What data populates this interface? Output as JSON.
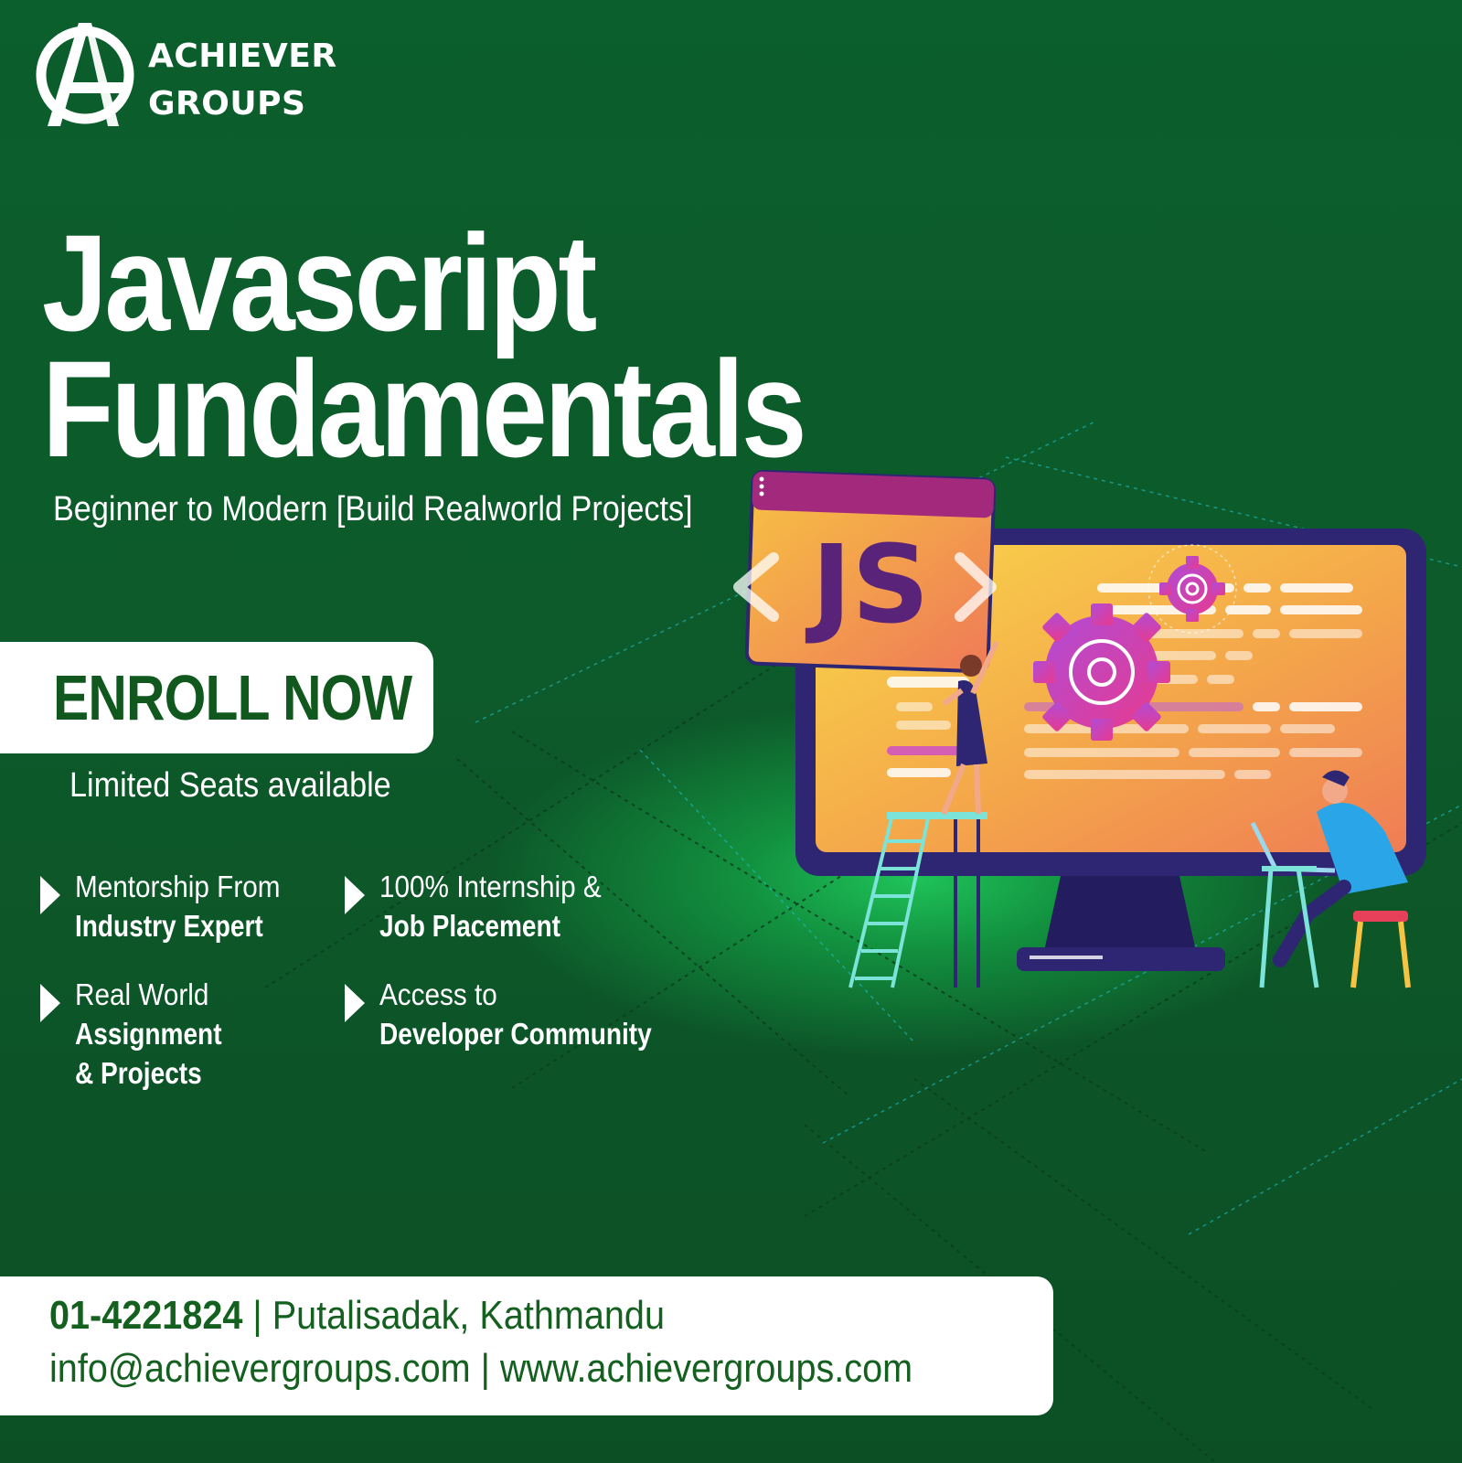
{
  "brand": {
    "line1": "ACHIEVER",
    "line2": "GROUPS"
  },
  "headline": {
    "line1": "Javascript",
    "line2": "Fundamentals"
  },
  "subtitle": "Beginner to Modern [Build Realworld Projects]",
  "cta": {
    "label": "ENROLL NOW",
    "note": "Limited Seats available"
  },
  "features": [
    {
      "line1": "Mentorship From",
      "line2": "Industry Expert",
      "line3": ""
    },
    {
      "line1": "100% Internship &",
      "line2": "Job Placement",
      "line3": ""
    },
    {
      "line1": "Real World",
      "line2": "Assignment",
      "line3": "& Projects"
    },
    {
      "line1": "Access to",
      "line2": "Developer Community",
      "line3": ""
    }
  ],
  "contact": {
    "phone": "01-4221824",
    "address": " | Putalisadak, Kathmandu",
    "line2": "info@achievergroups.com | www.achievergroups.com"
  },
  "illustration": {
    "badge_text": "JS"
  },
  "colors": {
    "background": "#0c5a2a",
    "accent_green": "#13601f",
    "white": "#ffffff"
  }
}
